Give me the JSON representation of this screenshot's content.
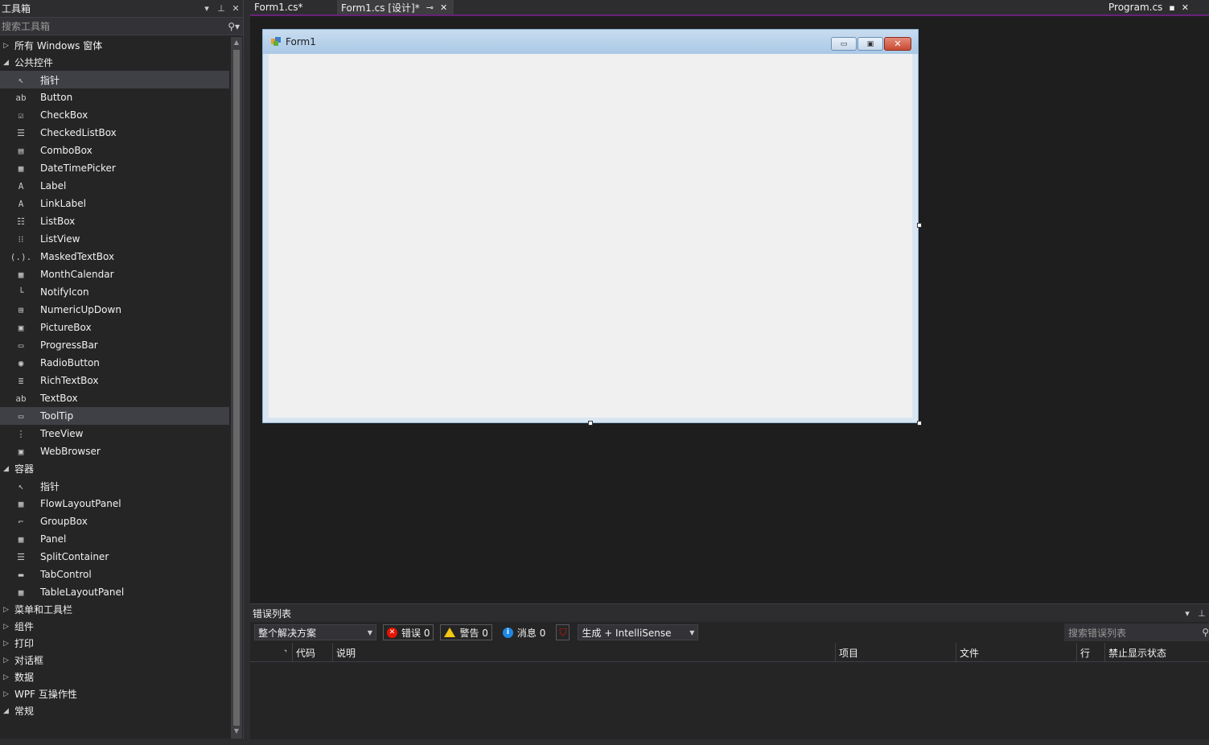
{
  "toolbox": {
    "title": "工具箱",
    "search_placeholder": "搜索工具箱",
    "title_buttons": {
      "dropdown": "▾",
      "pin": "⊥",
      "close": "✕"
    },
    "categories": [
      {
        "label": "所有 Windows 窗体",
        "expanded": false
      },
      {
        "label": "公共控件",
        "expanded": true
      }
    ],
    "common_items": [
      {
        "label": "指针",
        "icon": "pointer-icon",
        "glyph": "↖"
      },
      {
        "label": "Button",
        "icon": "button-icon",
        "glyph": "ab"
      },
      {
        "label": "CheckBox",
        "icon": "checkbox-icon",
        "glyph": "☑"
      },
      {
        "label": "CheckedListBox",
        "icon": "checkedlistbox-icon",
        "glyph": "☰"
      },
      {
        "label": "ComboBox",
        "icon": "combobox-icon",
        "glyph": "▤"
      },
      {
        "label": "DateTimePicker",
        "icon": "datetimepicker-icon",
        "glyph": "▦"
      },
      {
        "label": "Label",
        "icon": "label-icon",
        "glyph": "A"
      },
      {
        "label": "LinkLabel",
        "icon": "linklabel-icon",
        "glyph": "A"
      },
      {
        "label": "ListBox",
        "icon": "listbox-icon",
        "glyph": "☷"
      },
      {
        "label": "ListView",
        "icon": "listview-icon",
        "glyph": "⁝⁝"
      },
      {
        "label": "MaskedTextBox",
        "icon": "maskedtextbox-icon",
        "glyph": "(.)."
      },
      {
        "label": "MonthCalendar",
        "icon": "monthcalendar-icon",
        "glyph": "▦"
      },
      {
        "label": "NotifyIcon",
        "icon": "notifyicon-icon",
        "glyph": "└"
      },
      {
        "label": "NumericUpDown",
        "icon": "numericupdown-icon",
        "glyph": "⊞"
      },
      {
        "label": "PictureBox",
        "icon": "picturebox-icon",
        "glyph": "▣"
      },
      {
        "label": "ProgressBar",
        "icon": "progressbar-icon",
        "glyph": "▭"
      },
      {
        "label": "RadioButton",
        "icon": "radiobutton-icon",
        "glyph": "◉"
      },
      {
        "label": "RichTextBox",
        "icon": "richtextbox-icon",
        "glyph": "≣"
      },
      {
        "label": "TextBox",
        "icon": "textbox-icon",
        "glyph": "ab"
      },
      {
        "label": "ToolTip",
        "icon": "tooltip-icon",
        "glyph": "▭"
      },
      {
        "label": "TreeView",
        "icon": "treeview-icon",
        "glyph": "⋮"
      },
      {
        "label": "WebBrowser",
        "icon": "webbrowser-icon",
        "glyph": "▣"
      }
    ],
    "container_category": "容器",
    "container_items": [
      {
        "label": "指针",
        "icon": "pointer-icon",
        "glyph": "↖"
      },
      {
        "label": "FlowLayoutPanel",
        "icon": "flowlayoutpanel-icon",
        "glyph": "▦"
      },
      {
        "label": "GroupBox",
        "icon": "groupbox-icon",
        "glyph": "⌐"
      },
      {
        "label": "Panel",
        "icon": "panel-icon",
        "glyph": "▦"
      },
      {
        "label": "SplitContainer",
        "icon": "splitcontainer-icon",
        "glyph": "☰"
      },
      {
        "label": "TabControl",
        "icon": "tabcontrol-icon",
        "glyph": "▬"
      },
      {
        "label": "TableLayoutPanel",
        "icon": "tablelayoutpanel-icon",
        "glyph": "▦"
      }
    ],
    "more_categories": [
      {
        "label": "菜单和工具栏",
        "expanded": false
      },
      {
        "label": "组件",
        "expanded": false
      },
      {
        "label": "打印",
        "expanded": false
      },
      {
        "label": "对话框",
        "expanded": false
      },
      {
        "label": "数据",
        "expanded": false
      },
      {
        "label": "WPF 互操作性",
        "expanded": false
      },
      {
        "label": "常规",
        "expanded": true
      }
    ]
  },
  "tabs": {
    "form1cs": "Form1.cs*",
    "form1design": "Form1.cs [设计]*",
    "program": "Program.cs"
  },
  "form": {
    "title": "Form1"
  },
  "errorlist": {
    "title": "错误列表",
    "scope": "整个解决方案",
    "errors": "错误 0",
    "warnings": "警告 0",
    "messages": "消息 0",
    "build_filter": "生成 + IntelliSense",
    "search_placeholder": "搜索错误列表",
    "columns": {
      "code": "代码",
      "description": "说明",
      "project": "项目",
      "file": "文件",
      "line": "行",
      "suppression": "禁止显示状态"
    }
  },
  "colors": {
    "accent": "#68217a",
    "background": "#1e1e1e",
    "panel": "#252526"
  }
}
